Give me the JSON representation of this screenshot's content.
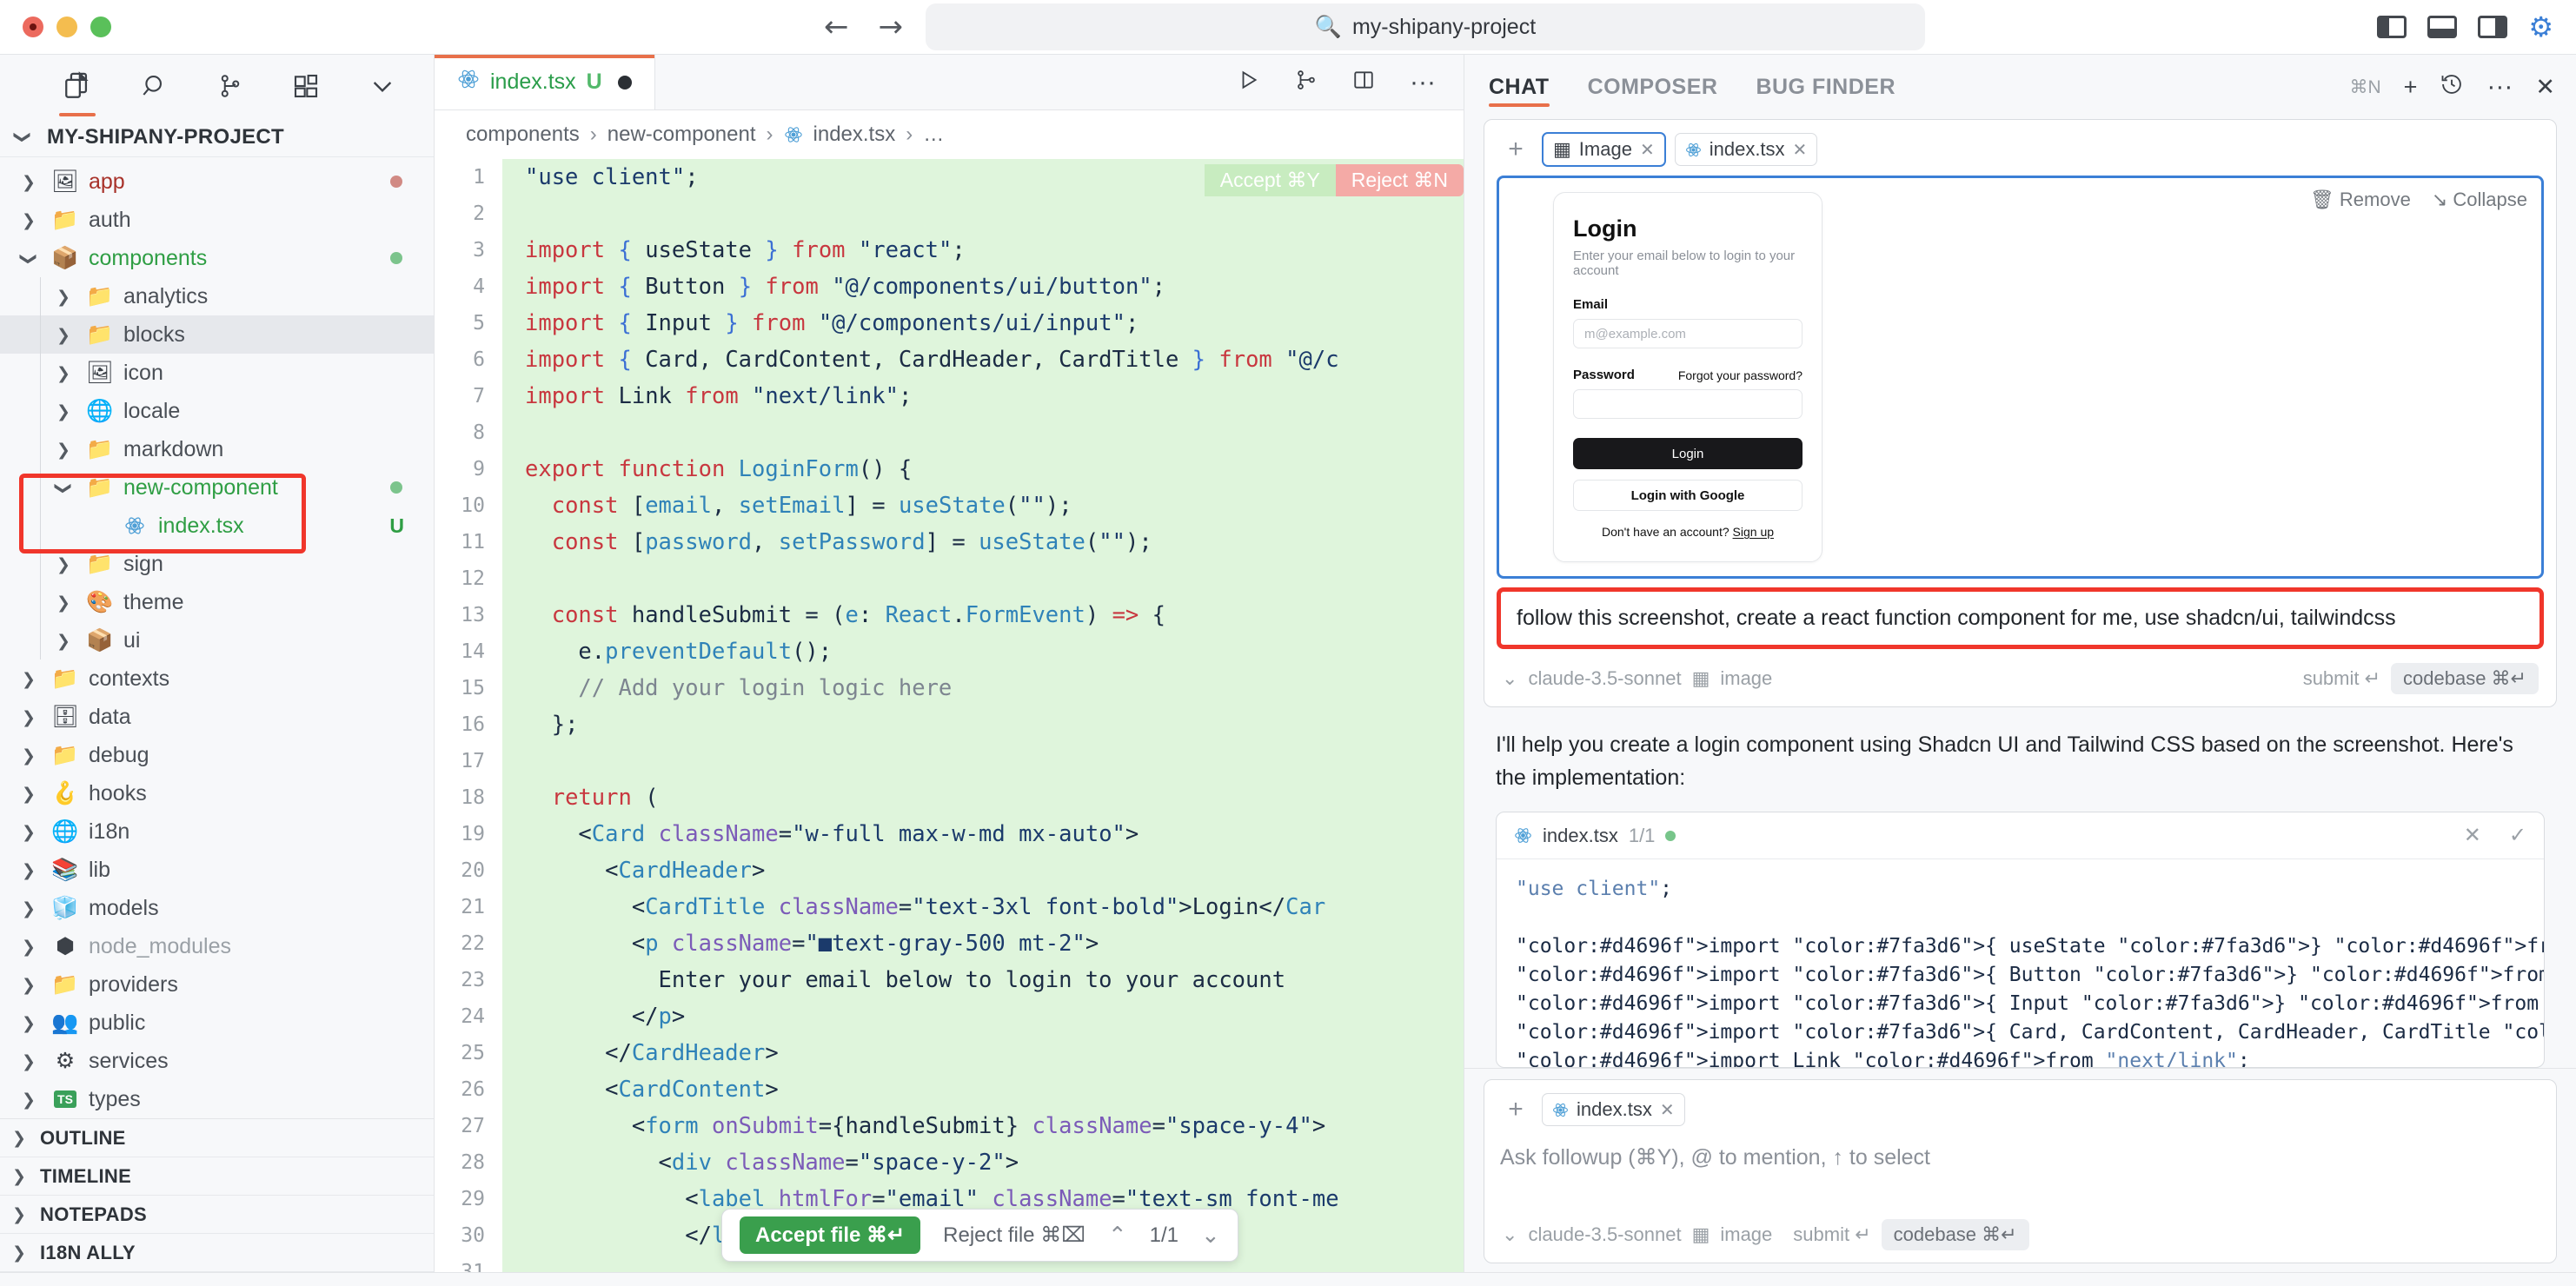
{
  "titlebar": {
    "search_value": "my-shipany-project",
    "search_icon": "search-icon",
    "back_icon": "arrow-left-icon",
    "forward_icon": "arrow-right-icon",
    "toggle_left_panel": "layout-left-icon",
    "toggle_bottom_panel": "layout-bottom-icon",
    "toggle_right_panel": "layout-right-icon",
    "settings_icon": "gear-icon"
  },
  "sidebar": {
    "icons": [
      {
        "name": "explorer-icon",
        "active": true
      },
      {
        "name": "search-icon",
        "active": false
      },
      {
        "name": "source-control-icon",
        "active": false
      },
      {
        "name": "extensions-icon",
        "active": false
      },
      {
        "name": "chevron-down-icon",
        "active": false
      }
    ],
    "project_title": "MY-SHIPANY-PROJECT",
    "tree": [
      {
        "label": "app",
        "indent": 1,
        "twisty": "right",
        "icon": "🖼",
        "iconcls": "f-app",
        "color": "#a8322a",
        "status": "",
        "dotcolor": "#d18a84"
      },
      {
        "label": "auth",
        "indent": 1,
        "twisty": "right",
        "icon": "📁",
        "iconcls": "f-plain",
        "color": "#4a4f56",
        "status": "",
        "dotcolor": ""
      },
      {
        "label": "components",
        "indent": 1,
        "twisty": "down",
        "icon": "📦",
        "iconcls": "f-pkg",
        "color": "#2f9e44",
        "status": "",
        "dotcolor": "#7cc48c"
      },
      {
        "label": "analytics",
        "indent": 2,
        "twisty": "right",
        "icon": "📁",
        "iconcls": "f-plain",
        "color": "#4a4f56",
        "status": "",
        "dotcolor": ""
      },
      {
        "label": "blocks",
        "indent": 2,
        "twisty": "right",
        "icon": "📁",
        "iconcls": "f-plain",
        "color": "#4a4f56",
        "status": "",
        "dotcolor": "",
        "selected": true
      },
      {
        "label": "icon",
        "indent": 2,
        "twisty": "right",
        "icon": "🖼",
        "iconcls": "f-img",
        "color": "#4a4f56",
        "status": "",
        "dotcolor": ""
      },
      {
        "label": "locale",
        "indent": 2,
        "twisty": "right",
        "icon": "🌐",
        "iconcls": "f-loc",
        "color": "#4a4f56",
        "status": "",
        "dotcolor": ""
      },
      {
        "label": "markdown",
        "indent": 2,
        "twisty": "right",
        "icon": "📁",
        "iconcls": "f-plain",
        "color": "#4a4f56",
        "status": "",
        "dotcolor": ""
      },
      {
        "label": "new-component",
        "indent": 2,
        "twisty": "down",
        "icon": "📁",
        "iconcls": "f-plain",
        "color": "#2f9e44",
        "status": "",
        "dotcolor": "#7cc48c"
      },
      {
        "label": "index.tsx",
        "indent": 3,
        "twisty": "none",
        "icon": "⚛",
        "iconcls": "f-react",
        "color": "#2f9e44",
        "status": "U",
        "dotcolor": ""
      },
      {
        "label": "sign",
        "indent": 2,
        "twisty": "right",
        "icon": "📁",
        "iconcls": "f-plain",
        "color": "#4a4f56",
        "status": "",
        "dotcolor": ""
      },
      {
        "label": "theme",
        "indent": 2,
        "twisty": "right",
        "icon": "🎨",
        "iconcls": "f-theme",
        "color": "#4a4f56",
        "status": "",
        "dotcolor": ""
      },
      {
        "label": "ui",
        "indent": 2,
        "twisty": "right",
        "icon": "📦",
        "iconcls": "f-pkg",
        "color": "#4a4f56",
        "status": "",
        "dotcolor": ""
      },
      {
        "label": "contexts",
        "indent": 1,
        "twisty": "right",
        "icon": "📁",
        "iconcls": "f-plain",
        "color": "#4a4f56",
        "status": "",
        "dotcolor": ""
      },
      {
        "label": "data",
        "indent": 1,
        "twisty": "right",
        "icon": "🗄",
        "iconcls": "f-data",
        "color": "#4a4f56",
        "status": "",
        "dotcolor": ""
      },
      {
        "label": "debug",
        "indent": 1,
        "twisty": "right",
        "icon": "📁",
        "iconcls": "f-plain",
        "color": "#4a4f56",
        "status": "",
        "dotcolor": ""
      },
      {
        "label": "hooks",
        "indent": 1,
        "twisty": "right",
        "icon": "🪝",
        "iconcls": "f-hook",
        "color": "#4a4f56",
        "status": "",
        "dotcolor": ""
      },
      {
        "label": "i18n",
        "indent": 1,
        "twisty": "right",
        "icon": "🌐",
        "iconcls": "f-loc",
        "color": "#4a4f56",
        "status": "",
        "dotcolor": ""
      },
      {
        "label": "lib",
        "indent": 1,
        "twisty": "right",
        "icon": "📚",
        "iconcls": "f-lib",
        "color": "#4a4f56",
        "status": "",
        "dotcolor": ""
      },
      {
        "label": "models",
        "indent": 1,
        "twisty": "right",
        "icon": "🧊",
        "iconcls": "f-model",
        "color": "#4a4f56",
        "status": "",
        "dotcolor": ""
      },
      {
        "label": "node_modules",
        "indent": 1,
        "twisty": "right",
        "icon": "⬢",
        "iconcls": "f-node",
        "color": "#9aa0a6",
        "status": "",
        "dotcolor": ""
      },
      {
        "label": "providers",
        "indent": 1,
        "twisty": "right",
        "icon": "📁",
        "iconcls": "f-plain",
        "color": "#4a4f56",
        "status": "",
        "dotcolor": ""
      },
      {
        "label": "public",
        "indent": 1,
        "twisty": "right",
        "icon": "👥",
        "iconcls": "f-pub",
        "color": "#4a4f56",
        "status": "",
        "dotcolor": ""
      },
      {
        "label": "services",
        "indent": 1,
        "twisty": "right",
        "icon": "⚙",
        "iconcls": "f-svc",
        "color": "#4a4f56",
        "status": "",
        "dotcolor": ""
      },
      {
        "label": "types",
        "indent": 1,
        "twisty": "right",
        "icon": "TS",
        "iconcls": "f-ts",
        "color": "#4a4f56",
        "status": "",
        "dotcolor": ""
      }
    ],
    "sections": [
      "OUTLINE",
      "TIMELINE",
      "NOTEPADS",
      "I18N ALLY"
    ]
  },
  "editor": {
    "tab": {
      "filename": "index.tsx",
      "badge": "U",
      "modified": true,
      "icon": "react-icon"
    },
    "toolbar": [
      {
        "name": "run-icon",
        "glyph": "▷"
      },
      {
        "name": "branch-merge-icon",
        "glyph": "⎇"
      },
      {
        "name": "split-editor-icon",
        "glyph": "◫"
      },
      {
        "name": "more-actions-icon",
        "glyph": "···"
      }
    ],
    "breadcrumb": [
      "components",
      "new-component",
      "index.tsx",
      "…"
    ],
    "diff": {
      "accept_label": "Accept ⌘Y",
      "reject_label": "Reject ⌘N"
    },
    "accept_bar": {
      "accept_file": "Accept file ⌘↵",
      "reject_file": "Reject file ⌘⌧",
      "prev_icon": "chevron-up-icon",
      "next_icon": "chevron-down-icon",
      "counter": "1/1"
    },
    "lines": [
      {
        "n": "1",
        "html": "<span class=\"s\">\"use client\"</span><span class=\"pl\">;</span>"
      },
      {
        "n": "2",
        "html": ""
      },
      {
        "n": "3",
        "html": "<span class=\"k\">import</span> <span class=\"b\">{</span> <span class=\"pl\">useState</span> <span class=\"b\">}</span> <span class=\"k\">from</span> <span class=\"s\">\"react\"</span><span class=\"pl\">;</span>"
      },
      {
        "n": "4",
        "html": "<span class=\"k\">import</span> <span class=\"b\">{</span> <span class=\"pl\">Button</span> <span class=\"b\">}</span> <span class=\"k\">from</span> <span class=\"s\">\"@/components/ui/button\"</span><span class=\"pl\">;</span>"
      },
      {
        "n": "5",
        "html": "<span class=\"k\">import</span> <span class=\"b\">{</span> <span class=\"pl\">Input</span> <span class=\"b\">}</span> <span class=\"k\">from</span> <span class=\"s\">\"@/components/ui/input\"</span><span class=\"pl\">;</span>"
      },
      {
        "n": "6",
        "html": "<span class=\"k\">import</span> <span class=\"b\">{</span> <span class=\"pl\">Card, CardContent, CardHeader, CardTitle</span> <span class=\"b\">}</span> <span class=\"k\">from</span> <span class=\"s\">\"@/c</span>"
      },
      {
        "n": "7",
        "html": "<span class=\"k\">import</span> <span class=\"pl\">Link</span> <span class=\"k\">from</span> <span class=\"s\">\"next/link\"</span><span class=\"pl\">;</span>"
      },
      {
        "n": "8",
        "html": ""
      },
      {
        "n": "9",
        "html": "<span class=\"k\">export</span> <span class=\"k\">function</span> <span class=\"fn\">LoginForm</span><span class=\"pl\">() {</span>"
      },
      {
        "n": "10",
        "html": "  <span class=\"k\">const</span> <span class=\"pl\">[</span><span class=\"t\">email</span><span class=\"pl\">, </span><span class=\"t\">setEmail</span><span class=\"pl\">] = </span><span class=\"fn\">useState</span><span class=\"pl\">(</span><span class=\"s\">\"\"</span><span class=\"pl\">);</span>"
      },
      {
        "n": "11",
        "html": "  <span class=\"k\">const</span> <span class=\"pl\">[</span><span class=\"t\">password</span><span class=\"pl\">, </span><span class=\"t\">setPassword</span><span class=\"pl\">] = </span><span class=\"fn\">useState</span><span class=\"pl\">(</span><span class=\"s\">\"\"</span><span class=\"pl\">);</span>"
      },
      {
        "n": "12",
        "html": ""
      },
      {
        "n": "13",
        "html": "  <span class=\"k\">const</span> <span class=\"pl\">handleSubmit = (</span><span class=\"t\">e</span><span class=\"pl\">: </span><span class=\"t\">React</span><span class=\"pl\">.</span><span class=\"t\">FormEvent</span><span class=\"pl\">) </span><span class=\"k\">=&gt;</span><span class=\"pl\"> {</span>"
      },
      {
        "n": "14",
        "html": "    <span class=\"pl\">e.</span><span class=\"fn\">preventDefault</span><span class=\"pl\">();</span>"
      },
      {
        "n": "15",
        "html": "    <span class=\"c\">// Add your login logic here</span>"
      },
      {
        "n": "16",
        "html": "  <span class=\"pl\">};</span>"
      },
      {
        "n": "17",
        "html": ""
      },
      {
        "n": "18",
        "html": "  <span class=\"k\">return</span> <span class=\"pl\">(</span>"
      },
      {
        "n": "19",
        "html": "    <span class=\"pl\">&lt;</span><span class=\"t\">Card</span> <span class=\"a\">className</span><span class=\"pl\">=</span><span class=\"s\">\"w-full max-w-md mx-auto\"</span><span class=\"pl\">&gt;</span>"
      },
      {
        "n": "20",
        "html": "      <span class=\"pl\">&lt;</span><span class=\"t\">CardHeader</span><span class=\"pl\">&gt;</span>"
      },
      {
        "n": "21",
        "html": "        <span class=\"pl\">&lt;</span><span class=\"t\">CardTitle</span> <span class=\"a\">className</span><span class=\"pl\">=</span><span class=\"s\">\"text-3xl font-bold\"</span><span class=\"pl\">&gt;Login&lt;/</span><span class=\"t\">Car</span>"
      },
      {
        "n": "22",
        "html": "        <span class=\"pl\">&lt;</span><span class=\"t\">p</span> <span class=\"a\">className</span><span class=\"pl\">=</span><span class=\"s\">\"■text-gray-500 mt-2\"</span><span class=\"pl\">&gt;</span>"
      },
      {
        "n": "23",
        "html": "          <span class=\"pl\">Enter your email below to login to your account</span>"
      },
      {
        "n": "24",
        "html": "        <span class=\"pl\">&lt;/</span><span class=\"t\">p</span><span class=\"pl\">&gt;</span>"
      },
      {
        "n": "25",
        "html": "      <span class=\"pl\">&lt;/</span><span class=\"t\">CardHeader</span><span class=\"pl\">&gt;</span>"
      },
      {
        "n": "26",
        "html": "      <span class=\"pl\">&lt;</span><span class=\"t\">CardContent</span><span class=\"pl\">&gt;</span>"
      },
      {
        "n": "27",
        "html": "        <span class=\"pl\">&lt;</span><span class=\"t\">form</span> <span class=\"a\">onSubmit</span><span class=\"pl\">={handleSubmit} </span><span class=\"a\">className</span><span class=\"pl\">=</span><span class=\"s\">\"space-y-4\"</span><span class=\"pl\">&gt;</span>"
      },
      {
        "n": "28",
        "html": "          <span class=\"pl\">&lt;</span><span class=\"t\">div</span> <span class=\"a\">className</span><span class=\"pl\">=</span><span class=\"s\">\"space-y-2\"</span><span class=\"pl\">&gt;</span>"
      },
      {
        "n": "29",
        "html": "            <span class=\"pl\">&lt;</span><span class=\"t\">label</span> <span class=\"a\">htmlFor</span><span class=\"pl\">=</span><span class=\"s\">\"email\"</span> <span class=\"a\">className</span><span class=\"pl\">=</span><span class=\"s\">\"text-sm font-me</span>"
      },
      {
        "n": "30",
        "html": "            <span class=\"pl\">&lt;/</span><span class=\"t\">label</span><span class=\"pl\">&gt;</span>"
      },
      {
        "n": "31",
        "html": ""
      }
    ]
  },
  "chat": {
    "tabs": [
      {
        "label": "CHAT",
        "active": true
      },
      {
        "label": "COMPOSER",
        "active": false
      },
      {
        "label": "BUG FINDER",
        "active": false
      }
    ],
    "header_actions": {
      "shortcut": "⌘N",
      "new_icon": "plus-icon",
      "history_icon": "history-icon",
      "more_icon": "more-icon",
      "close_icon": "close-icon"
    },
    "message": {
      "add_context_icon": "plus-icon",
      "chips": [
        {
          "label": "Image",
          "icon": "image-icon",
          "selected": true,
          "close": "✕"
        },
        {
          "label": "index.tsx",
          "icon": "react-icon",
          "selected": false,
          "close": "✕"
        }
      ],
      "image_actions": {
        "remove": "Remove",
        "collapse": "Collapse",
        "remove_icon": "trash-icon",
        "collapse_icon": "collapse-icon"
      },
      "attached_image": {
        "title": "Login",
        "subtitle": "Enter your email below to login to your account",
        "email_label": "Email",
        "email_placeholder": "m@example.com",
        "password_label": "Password",
        "forgot_link": "Forgot your password?",
        "primary_button": "Login",
        "secondary_button": "Login with Google",
        "footer_text": "Don't have an account?",
        "footer_link": "Sign up"
      },
      "prompt": "follow this screenshot, create a react function component for me, use shadcn/ui, tailwindcss",
      "model": "claude-3.5-sonnet",
      "model_chevron_icon": "chevron-down-icon",
      "attachment_label": "image",
      "attachment_icon": "image-icon",
      "submit_label": "submit ↵",
      "codebase_label": "codebase ⌘↵"
    },
    "reply": {
      "text": "I'll help you create a login component using Shadcn UI and Tailwind CSS based on the screenshot. Here's the implementation:",
      "codeblock": {
        "filename": "index.tsx",
        "icon": "react-icon",
        "counter": "1/1",
        "dot": true,
        "reject_icon": "close-icon",
        "accept_icon": "check-icon",
        "code": "\"use client\";\n\nimport { useState } from \"react\";\nimport { Button } from \"@/components/ui/button\";\nimport { Input } from \"@/components/ui/input\";\nimport { Card, CardContent, CardHeader, CardTitle } from \"@/components/ui/card\";\nimport Link from \"next/link\";"
      }
    },
    "input": {
      "add_context_icon": "plus-icon",
      "chips": [
        {
          "label": "index.tsx",
          "icon": "react-icon",
          "close": "✕"
        }
      ],
      "placeholder": "Ask followup (⌘Y), @ to mention, ↑ to select",
      "model": "claude-3.5-sonnet",
      "model_chevron_icon": "chevron-down-icon",
      "attachment_label": "image",
      "attachment_icon": "image-icon",
      "submit_label": "submit ↵",
      "codebase_label": "codebase ⌘↵"
    }
  },
  "colors": {
    "accent_orange": "#e8704a",
    "highlight_red": "#f0362b",
    "diff_green": "#dff5dc",
    "selection_blue": "#3b7fd6",
    "green_text": "#2f9e44"
  }
}
